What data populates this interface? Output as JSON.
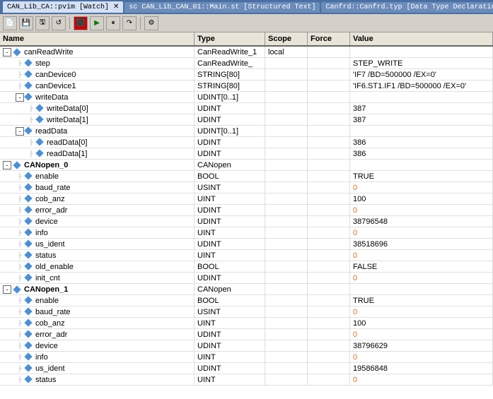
{
  "titlebar": {
    "tabs": [
      {
        "label": "CAN_Lib_CA::pvim [Watch]",
        "active": true
      },
      {
        "label": "sc CAN_Lib_CAN_01::Main.st [Structured Text]",
        "active": false
      },
      {
        "label": "Canfrd::Canfrd.typ [Data Type Declaration]",
        "active": false
      }
    ]
  },
  "toolbar": {
    "buttons": [
      "💾",
      "💾",
      "↺",
      "⬛",
      "▶",
      "⏹",
      "🔧"
    ]
  },
  "columns": {
    "name": "Name",
    "type": "Type",
    "scope": "Scope",
    "force": "Force",
    "value": "Value"
  },
  "rows": [
    {
      "id": "canReadWrite",
      "level": 0,
      "expandable": true,
      "name": "canReadWrite",
      "type": "CanReadWrite_1",
      "scope": "local",
      "force": "",
      "value": "",
      "diamond": true
    },
    {
      "id": "step",
      "level": 1,
      "expandable": false,
      "name": "step",
      "type": "CanReadWrite_",
      "scope": "",
      "force": "",
      "value": "STEP_WRITE",
      "diamond": true
    },
    {
      "id": "canDevice0",
      "level": 1,
      "expandable": false,
      "name": "canDevice0",
      "type": "STRING[80]",
      "scope": "",
      "force": "",
      "value": "'IF7 /BD=500000 /EX=0'",
      "diamond": true
    },
    {
      "id": "canDevice1",
      "level": 1,
      "expandable": false,
      "name": "canDevice1",
      "type": "STRING[80]",
      "scope": "",
      "force": "",
      "value": "'IF6.ST1.IF1 /BD=500000 /EX=0'",
      "diamond": true
    },
    {
      "id": "writeData",
      "level": 1,
      "expandable": true,
      "name": "writeData",
      "type": "UDINT[0..1]",
      "scope": "",
      "force": "",
      "value": "",
      "diamond": true
    },
    {
      "id": "writeData0",
      "level": 2,
      "expandable": false,
      "name": "writeData[0]",
      "type": "UDINT",
      "scope": "",
      "force": "",
      "value": "387",
      "diamond": true
    },
    {
      "id": "writeData1",
      "level": 2,
      "expandable": false,
      "name": "writeData[1]",
      "type": "UDINT",
      "scope": "",
      "force": "",
      "value": "387",
      "diamond": true
    },
    {
      "id": "readData",
      "level": 1,
      "expandable": true,
      "name": "readData",
      "type": "UDINT[0..1]",
      "scope": "",
      "force": "",
      "value": "",
      "diamond": true
    },
    {
      "id": "readData0",
      "level": 2,
      "expandable": false,
      "name": "readData[0]",
      "type": "UDINT",
      "scope": "",
      "force": "",
      "value": "386",
      "diamond": true
    },
    {
      "id": "readData1",
      "level": 2,
      "expandable": false,
      "name": "readData[1]",
      "type": "UDINT",
      "scope": "",
      "force": "",
      "value": "386",
      "diamond": true
    },
    {
      "id": "CANopen_0",
      "level": 0,
      "expandable": true,
      "name": "CANopen_0",
      "type": "CANopen",
      "scope": "",
      "force": "",
      "value": "",
      "diamond": true,
      "bold": true
    },
    {
      "id": "enable_0",
      "level": 1,
      "expandable": false,
      "name": "enable",
      "type": "BOOL",
      "scope": "",
      "force": "",
      "value": "TRUE",
      "diamond": true
    },
    {
      "id": "baud_rate_0",
      "level": 1,
      "expandable": false,
      "name": "baud_rate",
      "type": "USINT",
      "scope": "",
      "force": "",
      "value": "0",
      "valueColor": "orange",
      "diamond": true
    },
    {
      "id": "cob_anz_0",
      "level": 1,
      "expandable": false,
      "name": "cob_anz",
      "type": "UINT",
      "scope": "",
      "force": "",
      "value": "100",
      "diamond": true
    },
    {
      "id": "error_adr_0",
      "level": 1,
      "expandable": false,
      "name": "error_adr",
      "type": "UDINT",
      "scope": "",
      "force": "",
      "value": "0",
      "valueColor": "orange",
      "diamond": true
    },
    {
      "id": "device_0",
      "level": 1,
      "expandable": false,
      "name": "device",
      "type": "UDINT",
      "scope": "",
      "force": "",
      "value": "38796548",
      "diamond": true
    },
    {
      "id": "info_0",
      "level": 1,
      "expandable": false,
      "name": "info",
      "type": "UINT",
      "scope": "",
      "force": "",
      "value": "0",
      "valueColor": "orange",
      "diamond": true
    },
    {
      "id": "us_ident_0",
      "level": 1,
      "expandable": false,
      "name": "us_ident",
      "type": "UDINT",
      "scope": "",
      "force": "",
      "value": "38518696",
      "diamond": true
    },
    {
      "id": "status_0",
      "level": 1,
      "expandable": false,
      "name": "status",
      "type": "UINT",
      "scope": "",
      "force": "",
      "value": "0",
      "valueColor": "orange",
      "diamond": true
    },
    {
      "id": "old_enable_0",
      "level": 1,
      "expandable": false,
      "name": "old_enable",
      "type": "BOOL",
      "scope": "",
      "force": "",
      "value": "FALSE",
      "diamond": true
    },
    {
      "id": "init_cnt_0",
      "level": 1,
      "expandable": false,
      "name": "init_cnt",
      "type": "UDINT",
      "scope": "",
      "force": "",
      "value": "0",
      "valueColor": "orange",
      "diamond": true
    },
    {
      "id": "CANopen_1",
      "level": 0,
      "expandable": true,
      "name": "CANopen_1",
      "type": "CANopen",
      "scope": "",
      "force": "",
      "value": "",
      "diamond": true,
      "bold": true
    },
    {
      "id": "enable_1",
      "level": 1,
      "expandable": false,
      "name": "enable",
      "type": "BOOL",
      "scope": "",
      "force": "",
      "value": "TRUE",
      "diamond": true
    },
    {
      "id": "baud_rate_1",
      "level": 1,
      "expandable": false,
      "name": "baud_rate",
      "type": "USINT",
      "scope": "",
      "force": "",
      "value": "0",
      "valueColor": "orange",
      "diamond": true
    },
    {
      "id": "cob_anz_1",
      "level": 1,
      "expandable": false,
      "name": "cob_anz",
      "type": "UINT",
      "scope": "",
      "force": "",
      "value": "100",
      "diamond": true
    },
    {
      "id": "error_adr_1",
      "level": 1,
      "expandable": false,
      "name": "error_adr",
      "type": "UDINT",
      "scope": "",
      "force": "",
      "value": "0",
      "valueColor": "orange",
      "diamond": true
    },
    {
      "id": "device_1",
      "level": 1,
      "expandable": false,
      "name": "device",
      "type": "UDINT",
      "scope": "",
      "force": "",
      "value": "38796629",
      "diamond": true
    },
    {
      "id": "info_1",
      "level": 1,
      "expandable": false,
      "name": "info",
      "type": "UINT",
      "scope": "",
      "force": "",
      "value": "0",
      "valueColor": "orange",
      "diamond": true
    },
    {
      "id": "us_ident_1",
      "level": 1,
      "expandable": false,
      "name": "us_ident",
      "type": "UDINT",
      "scope": "",
      "force": "",
      "value": "19586848",
      "diamond": true
    },
    {
      "id": "status_1",
      "level": 1,
      "expandable": false,
      "name": "status",
      "type": "UINT",
      "scope": "",
      "force": "",
      "value": "0",
      "valueColor": "orange",
      "diamond": true
    }
  ]
}
